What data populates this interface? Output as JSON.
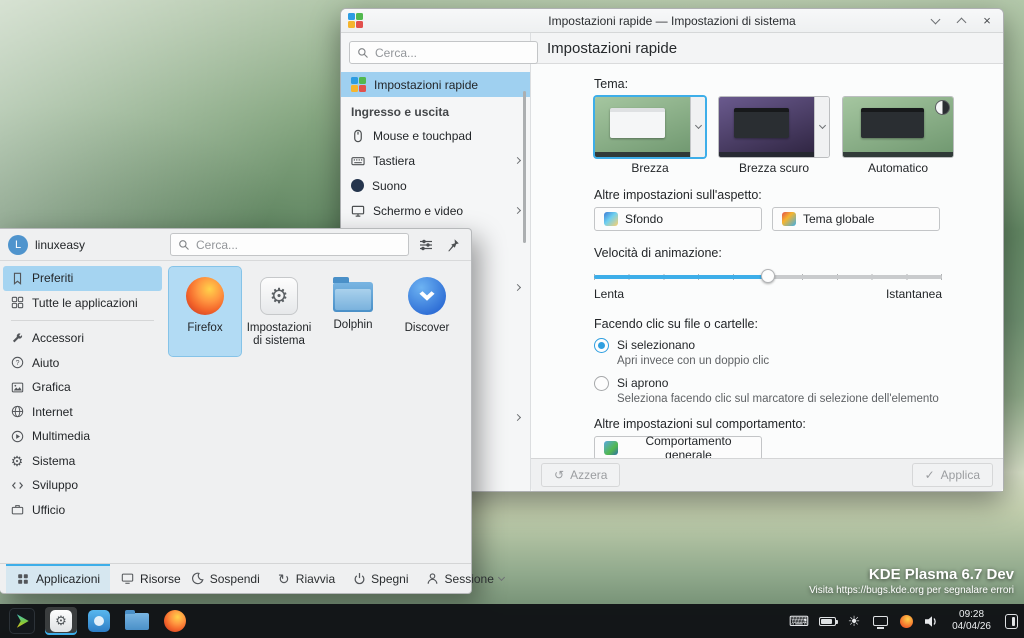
{
  "desktop": {
    "brand": "KDE Plasma 6.7 Dev",
    "bug_note": "Visita https://bugs.kde.org per segnalare errori"
  },
  "panel": {
    "clock_time": "09:28",
    "clock_date": "04/04/26"
  },
  "settings_window": {
    "title": "Impostazioni rapide — Impostazioni di sistema",
    "search_placeholder": "Cerca...",
    "nav": {
      "selected": "Impostazioni rapide",
      "quick_settings": "Impostazioni rapide",
      "section_io": "Ingresso e uscita",
      "items": [
        "Mouse e touchpad",
        "Tastiera",
        "Suono",
        "Schermo e video"
      ]
    },
    "page": {
      "header": "Impostazioni rapide",
      "theme_label": "Tema:",
      "themes": [
        "Brezza",
        "Brezza scuro",
        "Automatico"
      ],
      "selected_theme": "Brezza",
      "appearance_label": "Altre impostazioni sull'aspetto:",
      "wallpaper_button": "Sfondo",
      "global_theme_button": "Tema globale",
      "animation_label": "Velocità di animazione:",
      "animation_slow": "Lenta",
      "animation_fast": "Istantanea",
      "animation_value_percent": 50,
      "click_label": "Facendo clic su file o cartelle:",
      "radio_select": "Si selezionano",
      "radio_select_desc": "Apri invece con un doppio clic",
      "radio_open": "Si aprono",
      "radio_open_desc": "Seleziona facendo clic sul marcatore di selezione dell'elemento",
      "file_click_selected": "Si selezionano",
      "behavior_label": "Altre impostazioni sul comportamento:",
      "behavior_button": "Comportamento generale",
      "reset_button": "Azzera",
      "apply_button": "Applica"
    }
  },
  "launcher": {
    "username": "linuxeasy",
    "avatar_letter": "L",
    "search_placeholder": "Cerca...",
    "categories": [
      "Preferiti",
      "Tutte le applicazioni",
      "Accessori",
      "Aiuto",
      "Grafica",
      "Internet",
      "Multimedia",
      "Sistema",
      "Sviluppo",
      "Ufficio"
    ],
    "selected_category": "Preferiti",
    "favorites": [
      "Firefox",
      "Impostazioni di sistema",
      "Dolphin",
      "Discover"
    ],
    "selected_favorite": "Firefox",
    "tabs": [
      "Applicazioni",
      "Risorse"
    ],
    "selected_tab": "Applicazioni",
    "actions": [
      "Sospendi",
      "Riavvia",
      "Spegni",
      "Sessione"
    ]
  },
  "icons": {
    "close": "×",
    "gear": "⚙",
    "sun": "☀",
    "keyboard": "⌨",
    "restart": "↻",
    "reset": "↺",
    "check": "✓"
  }
}
